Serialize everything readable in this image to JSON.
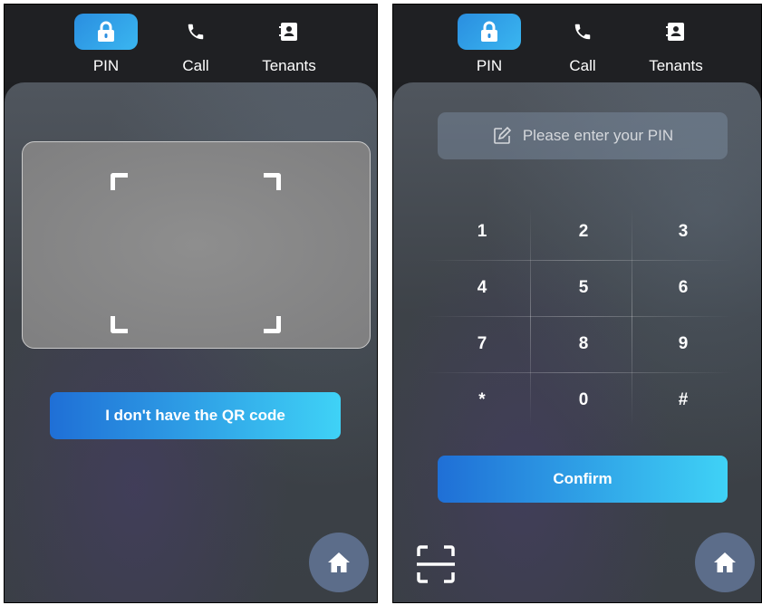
{
  "tabs": [
    {
      "label": "PIN",
      "icon": "lock-icon",
      "active": true
    },
    {
      "label": "Call",
      "icon": "phone-icon",
      "active": false
    },
    {
      "label": "Tenants",
      "icon": "contact-card-icon",
      "active": false
    }
  ],
  "left_panel": {
    "qr_button_label": "I don't have the QR code",
    "home_icon": "home-icon"
  },
  "right_panel": {
    "pin_placeholder": "Please enter your PIN",
    "keys": [
      "1",
      "2",
      "3",
      "4",
      "5",
      "6",
      "7",
      "8",
      "9",
      "*",
      "0",
      "#"
    ],
    "confirm_label": "Confirm",
    "scan_icon": "scan-qr-icon",
    "home_icon": "home-icon"
  },
  "colors": {
    "accent_start": "#1f6fd6",
    "accent_end": "#3fd2f6",
    "home_button": "#5c6d8a",
    "topbar": "#1f2023"
  }
}
